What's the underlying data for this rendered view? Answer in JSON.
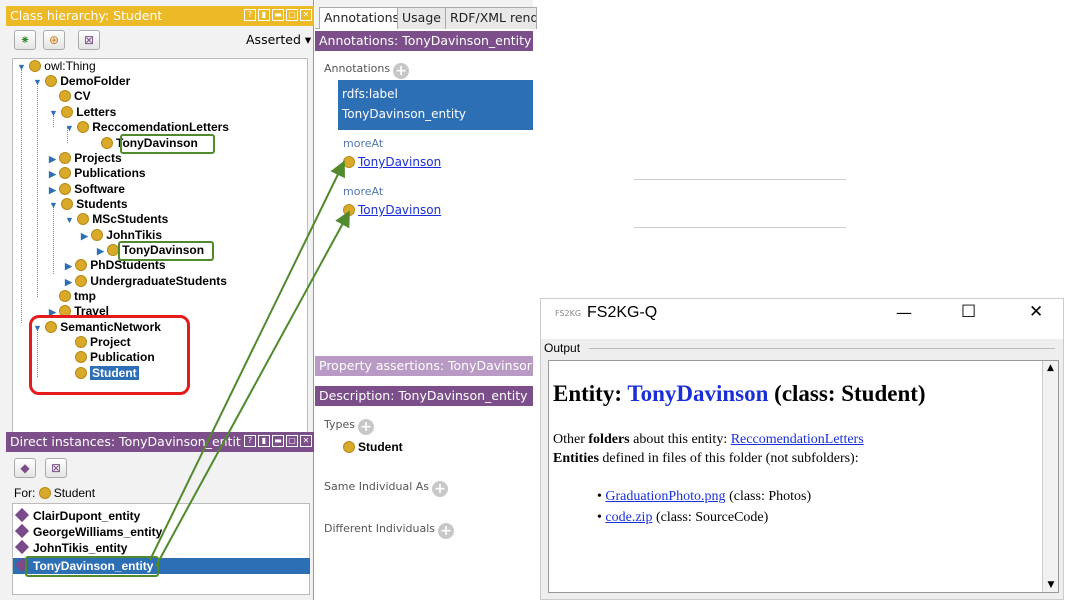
{
  "left": {
    "class_hierarchy": {
      "title": "Class hierarchy: Student",
      "mode": "Asserted",
      "tree": [
        {
          "label": "owl:Thing"
        },
        {
          "label": "DemoFolder"
        },
        {
          "label": "CV"
        },
        {
          "label": "Letters"
        },
        {
          "label": "ReccomendationLetters"
        },
        {
          "label": "TonyDavinson"
        },
        {
          "label": "Projects"
        },
        {
          "label": "Publications"
        },
        {
          "label": "Software"
        },
        {
          "label": "Students"
        },
        {
          "label": "MScStudents"
        },
        {
          "label": "JohnTikis"
        },
        {
          "label": "TonyDavinson"
        },
        {
          "label": "PhDStudents"
        },
        {
          "label": "UndergraduateStudents"
        },
        {
          "label": "tmp"
        },
        {
          "label": "Travel"
        },
        {
          "label": "SemanticNetwork"
        },
        {
          "label": "Project"
        },
        {
          "label": "Publication"
        },
        {
          "label": "Student"
        }
      ]
    },
    "instances": {
      "title": "Direct instances: TonyDavinson_entit",
      "for_label": "For:",
      "for_value": "Student",
      "items": [
        "ClairDupont_entity",
        "GeorgeWilliams_entity",
        "JohnTikis_entity",
        "TonyDavinson_entity"
      ]
    }
  },
  "middle": {
    "tabs": [
      "Annotations",
      "Usage",
      "RDF/XML rend"
    ],
    "annotations_header": "Annotations: TonyDavinson_entity",
    "annotations_label": "Annotations",
    "rdfs_label_key": "rdfs:label",
    "rdfs_label_value": "TonyDavinson_entity",
    "more_at_1_key": "moreAt",
    "more_at_1_value": "TonyDavinson",
    "more_at_2_key": "moreAt",
    "more_at_2_value": "TonyDavinson",
    "property_header": "Property assertions: TonyDavinsor",
    "description_header": "Description: TonyDavinson_entity",
    "types_label": "Types",
    "types_value": "Student",
    "same_label": "Same Individual As",
    "different_label": "Different Individuals"
  },
  "dialog": {
    "icon_text": "FS2KG",
    "title": "FS2KG-Q",
    "minimize": "—",
    "maximize": "☐",
    "close": "✕",
    "output_label": "Output",
    "heading_prefix": "Entity:",
    "entity_name": "TonyDavinson",
    "heading_suffix": "(class: Student)",
    "line1_a": "Other",
    "line1_b": "folders",
    "line1_c": "about this entity:",
    "line1_link": "ReccomendationLetters",
    "line2_a": "Entities",
    "line2_b": "defined in files of this folder (not subfolders):",
    "files": [
      {
        "name": "GraduationPhoto.png",
        "cls": "(class: Photos)"
      },
      {
        "name": "code.zip",
        "cls": "(class: SourceCode)"
      }
    ]
  },
  "colors": {
    "panel_header": "#ecb927",
    "purple_header": "#7c4f8a",
    "selection": "#2d6fb5",
    "highlight_green": "#4f8a2c",
    "highlight_red": "#e51a1a",
    "link": "#1a2fd6"
  }
}
